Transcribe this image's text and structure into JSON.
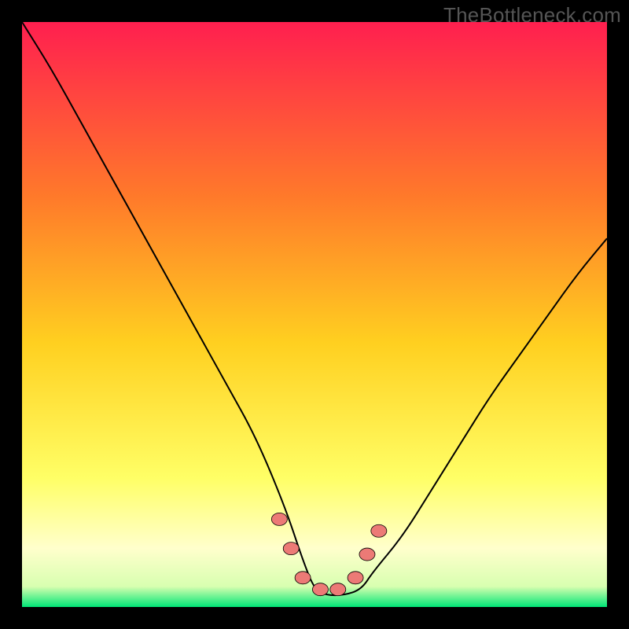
{
  "watermark": "TheBottleneck.com",
  "colors": {
    "frame_bg": "#000000",
    "gradient_top": "#ff1f4f",
    "gradient_mid_upper": "#ff7a2a",
    "gradient_mid": "#ffd020",
    "gradient_lower": "#ffff66",
    "gradient_pale": "#ffffcc",
    "gradient_bottom": "#00e676",
    "curve_stroke": "#000000",
    "marker_fill": "#ec7a76"
  },
  "chart_data": {
    "type": "line",
    "title": "",
    "xlabel": "",
    "ylabel": "",
    "xlim": [
      0,
      100
    ],
    "ylim": [
      0,
      100
    ],
    "series": [
      {
        "name": "bottleneck-curve",
        "x": [
          0,
          5,
          10,
          15,
          20,
          25,
          30,
          35,
          40,
          45,
          48,
          50,
          52,
          55,
          58,
          60,
          65,
          70,
          75,
          80,
          85,
          90,
          95,
          100
        ],
        "values": [
          100,
          92,
          83,
          74,
          65,
          56,
          47,
          38,
          29,
          17,
          8,
          3,
          2,
          2,
          3,
          6,
          12,
          20,
          28,
          36,
          43,
          50,
          57,
          63
        ]
      }
    ],
    "markers": {
      "name": "highlight-points",
      "x": [
        44,
        46,
        48,
        51,
        54,
        57,
        59,
        61
      ],
      "values": [
        15,
        10,
        5,
        3,
        3,
        5,
        9,
        13
      ]
    },
    "gradient_stops": [
      {
        "offset": 0.0,
        "color": "#ff1f4f"
      },
      {
        "offset": 0.3,
        "color": "#ff7a2a"
      },
      {
        "offset": 0.55,
        "color": "#ffd020"
      },
      {
        "offset": 0.78,
        "color": "#ffff66"
      },
      {
        "offset": 0.9,
        "color": "#ffffcc"
      },
      {
        "offset": 0.965,
        "color": "#d8ffb0"
      },
      {
        "offset": 1.0,
        "color": "#00e676"
      }
    ]
  }
}
